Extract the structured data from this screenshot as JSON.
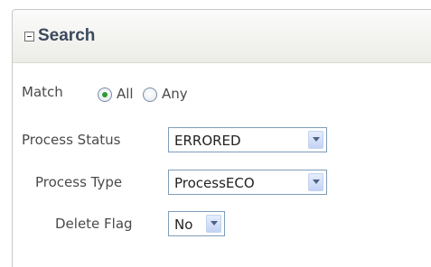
{
  "panel": {
    "title": "Search",
    "collapse_icon": "collapse-minus-icon"
  },
  "match": {
    "label": "Match",
    "options": [
      {
        "label": "All",
        "checked": true
      },
      {
        "label": "Any",
        "checked": false
      }
    ]
  },
  "fields": {
    "process_status": {
      "label": "Process Status",
      "value": "ERRORED"
    },
    "process_type": {
      "label": "Process Type",
      "value": "ProcessECO"
    },
    "delete_flag": {
      "label": "Delete Flag",
      "value": "No"
    }
  },
  "colors": {
    "title": "#3b4a5c",
    "radio_selected": "#2c9a36",
    "select_border": "#7f9db9"
  }
}
